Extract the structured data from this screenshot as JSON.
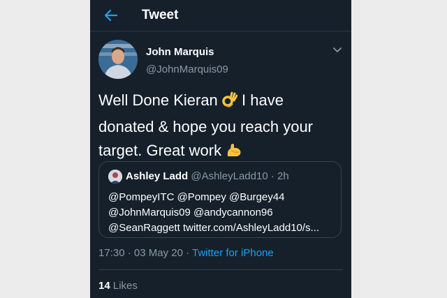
{
  "header": {
    "title": "Tweet"
  },
  "tweet": {
    "author_name": "John Marquis",
    "author_handle": "@JohnMarquis09",
    "text_part1": "Well Done Kieran",
    "text_part2": " I have donated & hope you reach your target. Great work",
    "emoji_1": "ok-hand-emoji",
    "emoji_2": "flexed-biceps-emoji",
    "time": "17:30",
    "separator": "·",
    "date": "03 May 20",
    "source": "Twitter for iPhone",
    "likes_count": "14",
    "likes_label": "Likes"
  },
  "quoted": {
    "name": "Ashley Ladd",
    "handle": "@AshleyLadd10",
    "separator": "·",
    "age": "2h",
    "line1": "@PompeyITC @Pompey @Burgey44",
    "line2": "@JohnMarquis09 @andycannon96",
    "line3": "@SeanRaggett twitter.com/AshleyLadd10/s..."
  },
  "colors": {
    "background": "#15202b",
    "accent": "#1da1f2",
    "secondary_text": "#8899a6",
    "border": "#38444d"
  }
}
